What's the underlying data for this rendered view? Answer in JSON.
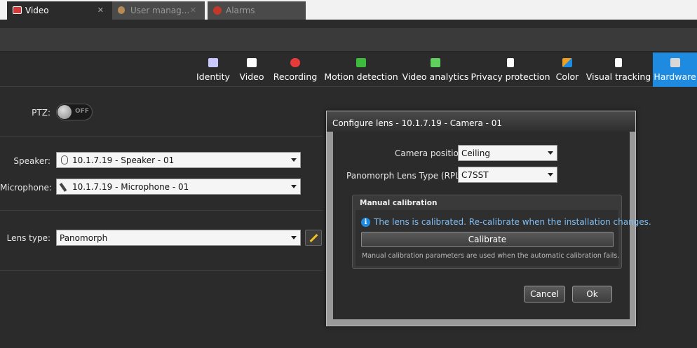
{
  "tabs": [
    {
      "label": "Video",
      "close": "✕",
      "active": true,
      "icon": "video-tab-icon",
      "icon_color": "#d23b3b"
    },
    {
      "label": "User manag...",
      "close": "✕",
      "active": false,
      "icon": "user-icon",
      "icon_color": "#b58a55"
    },
    {
      "label": "Alarms",
      "close": "",
      "active": false,
      "icon": "alarm-icon",
      "icon_color": "#c0392b"
    }
  ],
  "config_tabs": [
    {
      "label": "Identity",
      "icon": "identity-icon",
      "color": "#c8c8ff"
    },
    {
      "label": "Video",
      "icon": "video-icon",
      "color": "#ffffff"
    },
    {
      "label": "Recording",
      "icon": "recording-icon",
      "color": "#e53b3b"
    },
    {
      "label": "Motion detection",
      "icon": "motion-icon",
      "color": "#3dbb3d"
    },
    {
      "label": "Video analytics",
      "icon": "analytics-icon",
      "color": "#5fcf5f"
    },
    {
      "label": "Privacy protection",
      "icon": "privacy-icon",
      "color": "#ffffff"
    },
    {
      "label": "Color",
      "icon": "color-icon",
      "color": "#f0a020"
    },
    {
      "label": "Visual tracking",
      "icon": "tracking-icon",
      "color": "#ffffff"
    },
    {
      "label": "Hardware",
      "icon": "hardware-icon",
      "color": "#d8d8d8"
    }
  ],
  "ptz": {
    "label": "PTZ:",
    "state": "OFF"
  },
  "speaker": {
    "label": "Speaker:",
    "value": "10.1.7.19 - Speaker - 01"
  },
  "microphone": {
    "label": "Microphone:",
    "value": "10.1.7.19 - Microphone - 01"
  },
  "lens": {
    "label": "Lens type:",
    "value": "Panomorph"
  },
  "dialog": {
    "title": "Configure lens - 10.1.7.19 - Camera - 01",
    "camera_position_label": "Camera position:",
    "camera_position_value": "Ceiling",
    "lens_type_label": "Panomorph Lens Type (RPL):",
    "lens_type_value": "C7SST",
    "group_title": "Manual calibration",
    "info_text": "The lens is calibrated. Re-calibrate when the installation changes.",
    "calibrate_label": "Calibrate",
    "note": "Manual calibration parameters are used when the automatic calibration fails.",
    "cancel_label": "Cancel",
    "ok_label": "Ok"
  }
}
